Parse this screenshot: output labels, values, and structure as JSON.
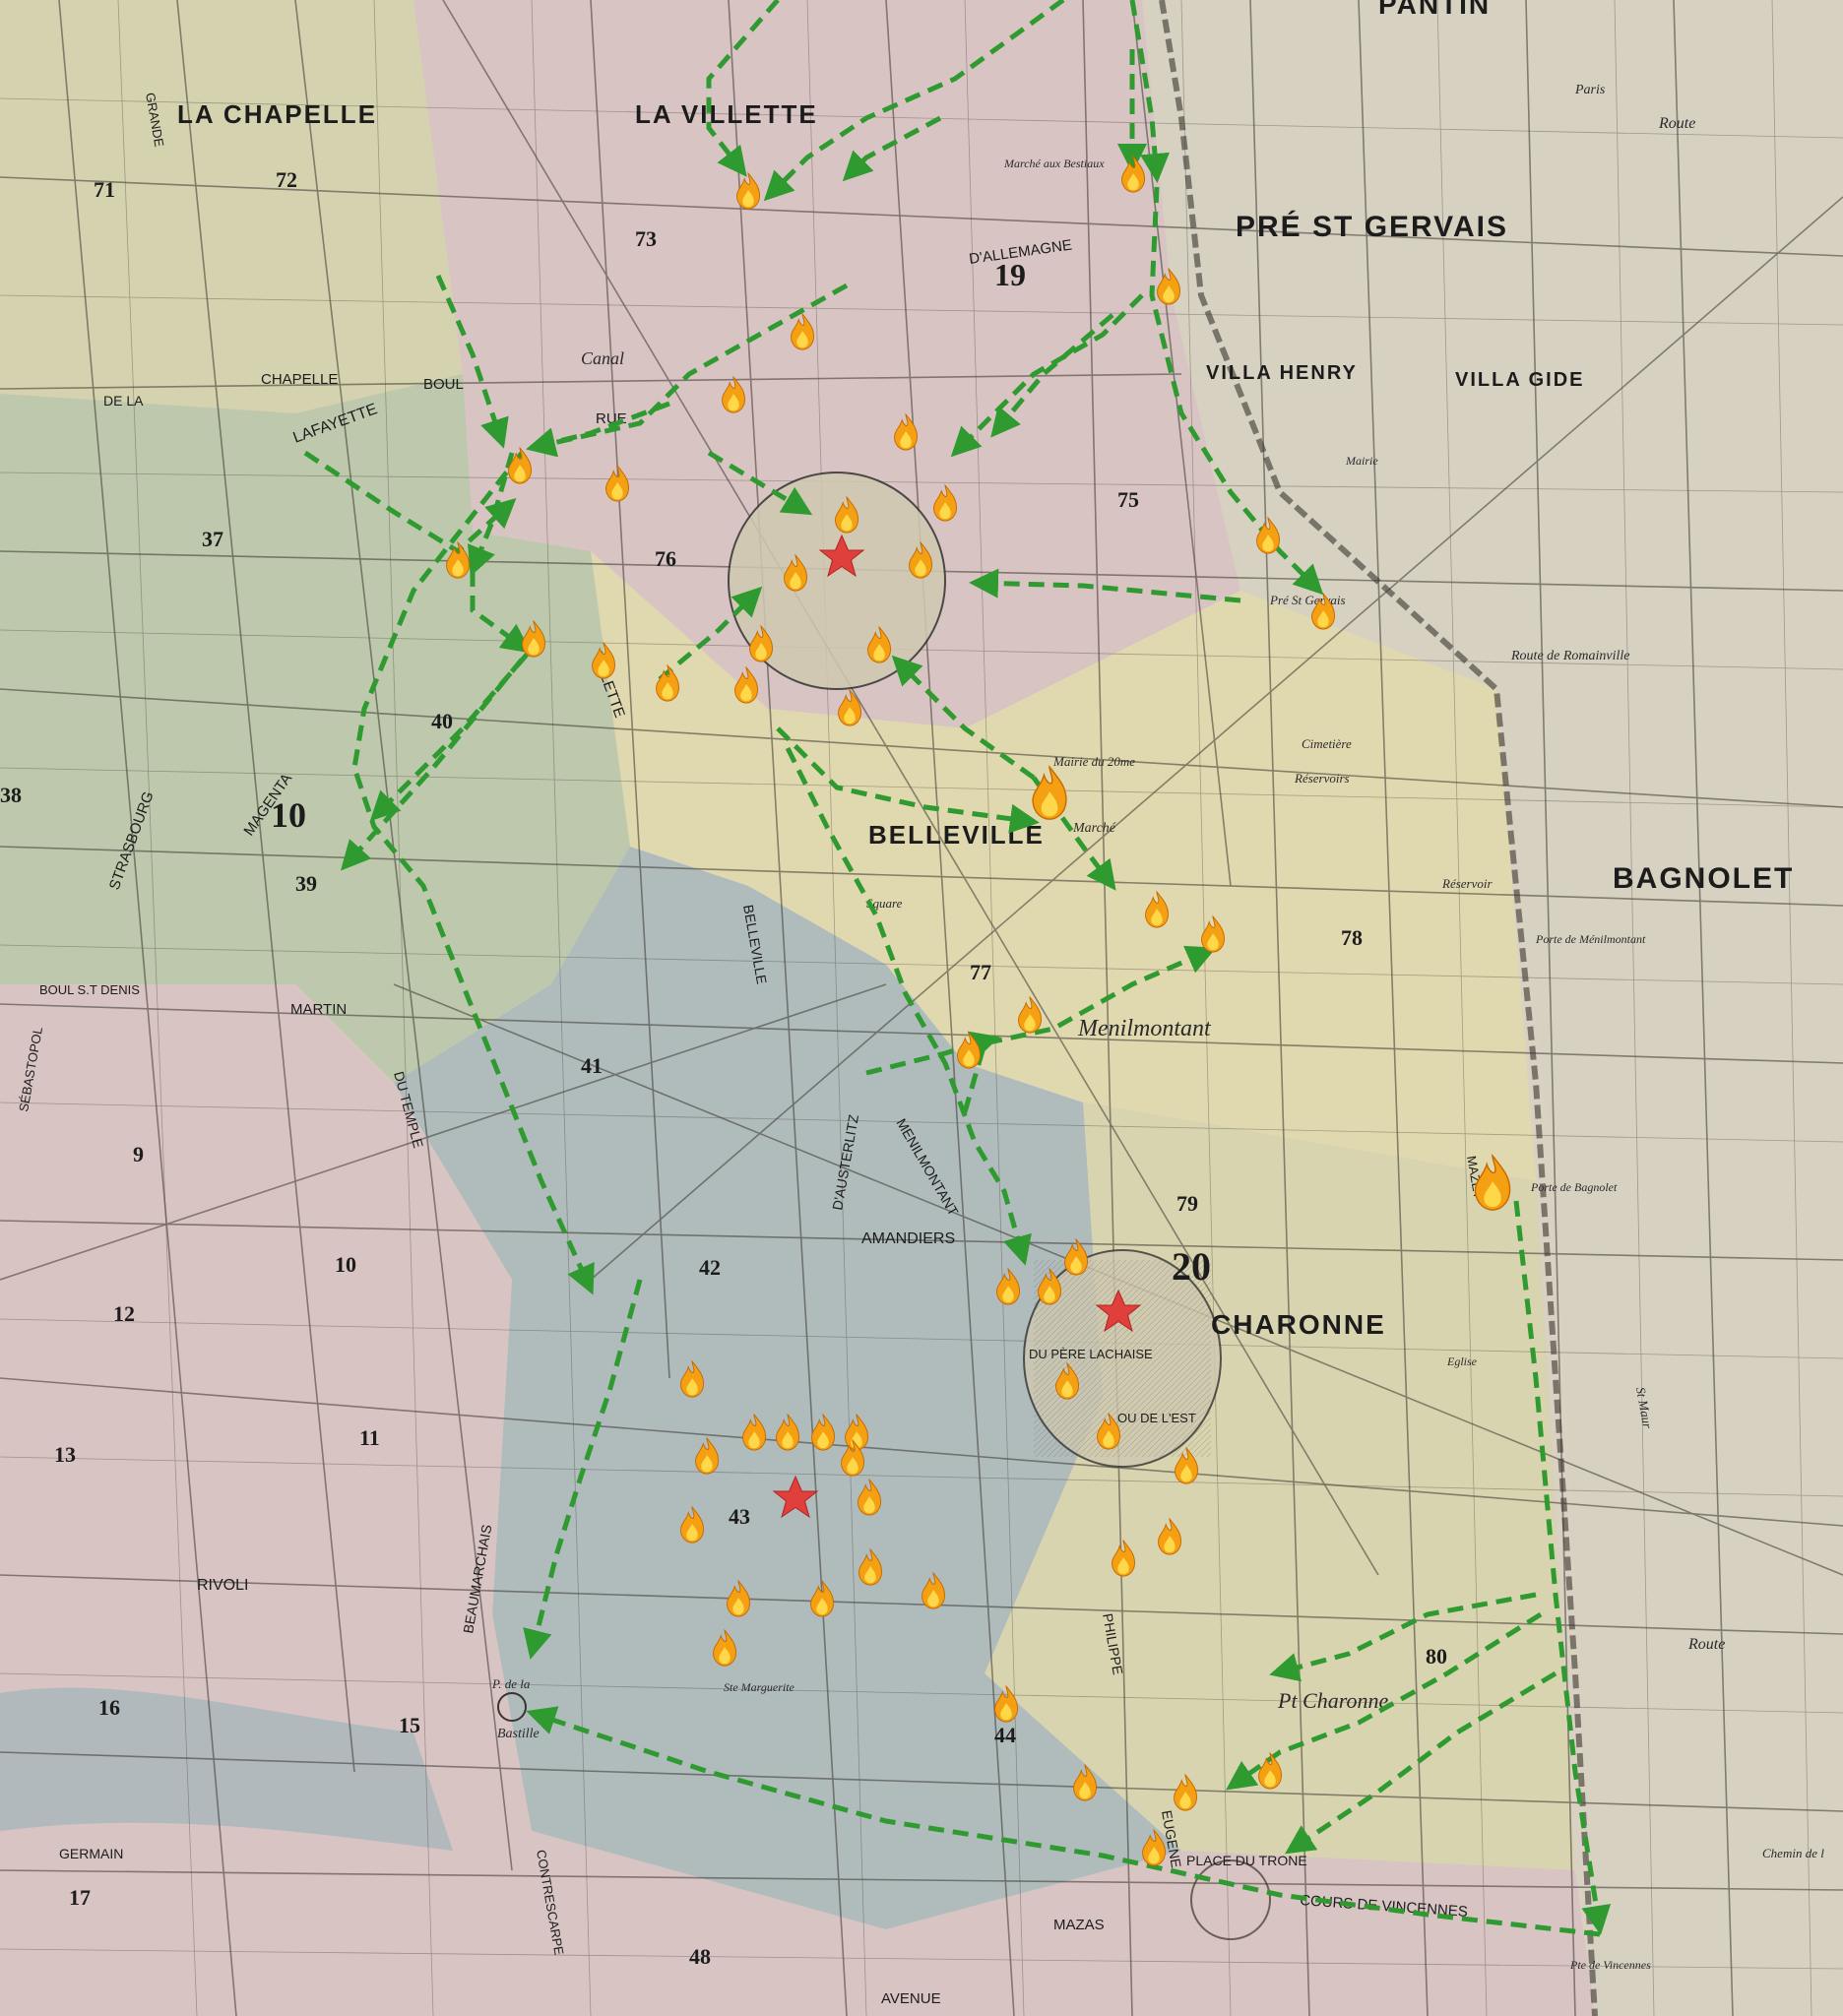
{
  "map": {
    "districts": {
      "pantin": "PANTIN",
      "la_chapelle": "LA CHAPELLE",
      "la_villette": "LA VILLETTE",
      "pre_st_gervais": "PRÉ ST GERVAIS",
      "villa_henry": "VILLA HENRY",
      "villa_gide": "VILLA GIDE",
      "belleville": "BELLEVILLE",
      "bagnolet": "BAGNOLET",
      "charonne": "CHARONNE",
      "menilmontant": "Menilmontant",
      "pt_charonne": "Pt Charonne"
    },
    "arrondissements": {
      "a19": "19",
      "a20": "20",
      "a10": "10"
    },
    "quarter_numbers": {
      "q71": "71",
      "q72": "72",
      "q73": "73",
      "q75": "75",
      "q76": "76",
      "q77": "77",
      "q78": "78",
      "q79": "79",
      "q80": "80",
      "q37": "37",
      "q38": "38",
      "q39": "39",
      "q40": "40",
      "q41": "41",
      "q42": "42",
      "q43": "43",
      "q44": "44",
      "q48": "48",
      "q9": "9",
      "q10": "10",
      "q11": "11",
      "q12": "12",
      "q13": "13",
      "q15": "15",
      "q16": "16",
      "q17": "17"
    },
    "streets": {
      "rue_lafayette": "LAFAYETTE",
      "chapelle": "CHAPELLE",
      "boul": "BOUL",
      "rue": "RUE",
      "de_la": "DE LA",
      "canal": "Canal",
      "allemagne": "D'ALLEMAGNE",
      "villette": "VILLETTE",
      "magenta": "MAGENTA",
      "strasbourg": "STRASBOURG",
      "martin": "MARTIN",
      "boul_st_denis": "BOUL S.T DENIS",
      "temple": "DU TEMPLE",
      "sebastopol": "SÉBASTOPOL",
      "amandiers": "AMANDIERS",
      "menilmontant_boul": "MENILMONTANT",
      "austerlitz": "D'AUSTERLITZ",
      "place_du_trone": "PLACE DU TRONE",
      "cours_de_vincennes": "COURS DE VINCENNES",
      "mazas": "MAZAS",
      "avenue": "AVENUE",
      "rivoli": "RIVOLI",
      "beaumarchais": "BEAUMARCHAIS",
      "bastille": "Bastille",
      "p_de_la": "P. de la",
      "belleville_boul": "BELLEVILLE",
      "philippe": "PHILIPPE",
      "route": "Route",
      "mairie_20": "Mairie du 20me",
      "marche": "Marché",
      "reservoirs": "Réservoirs",
      "cimetiere": "Cimetière",
      "reservoir": "Réservoir",
      "porte_menilmontant": "Porte de Ménilmontant",
      "porte_bagnolet": "Porte de Bagnolet",
      "porte_vincennes": "Pte de Vincennes",
      "marche_aux_bestiaux": "Marché aux Bestiaux",
      "pere_lachaise": "DU PÈRE LACHAISE",
      "ou_de_lest": "OU DE L'EST",
      "square_belleville": "Square",
      "st_marguerite": "Ste Marguerite",
      "grande": "GRANDE",
      "mazet": "MAZET",
      "eugene": "EUGENE",
      "chemin_de_l": "Chemin de l",
      "germain": "GERMAIN",
      "contrescarpe": "CONTRESCARPE",
      "pre_st_gervais_small": "Pré St Gervais",
      "route_romainville": "Route de Romainville",
      "route_montreuil": "Route",
      "paris": "Paris",
      "eglise": "Eglise",
      "mairie": "Mairie",
      "saint_maur": "St Maur"
    }
  },
  "colors": {
    "route": "#2f9a2f",
    "star": "#e0403c",
    "flame": "#f5a012",
    "zone_pink": "#d8c2c4",
    "zone_blue": "#a8b7bb",
    "zone_yellow": "#e0d8ae",
    "zone_green": "#b9c6aa",
    "paper": "#d9d2c3"
  },
  "markers": {
    "icon_names": [
      "fire-icon",
      "star-icon",
      "arrow-icon"
    ]
  }
}
